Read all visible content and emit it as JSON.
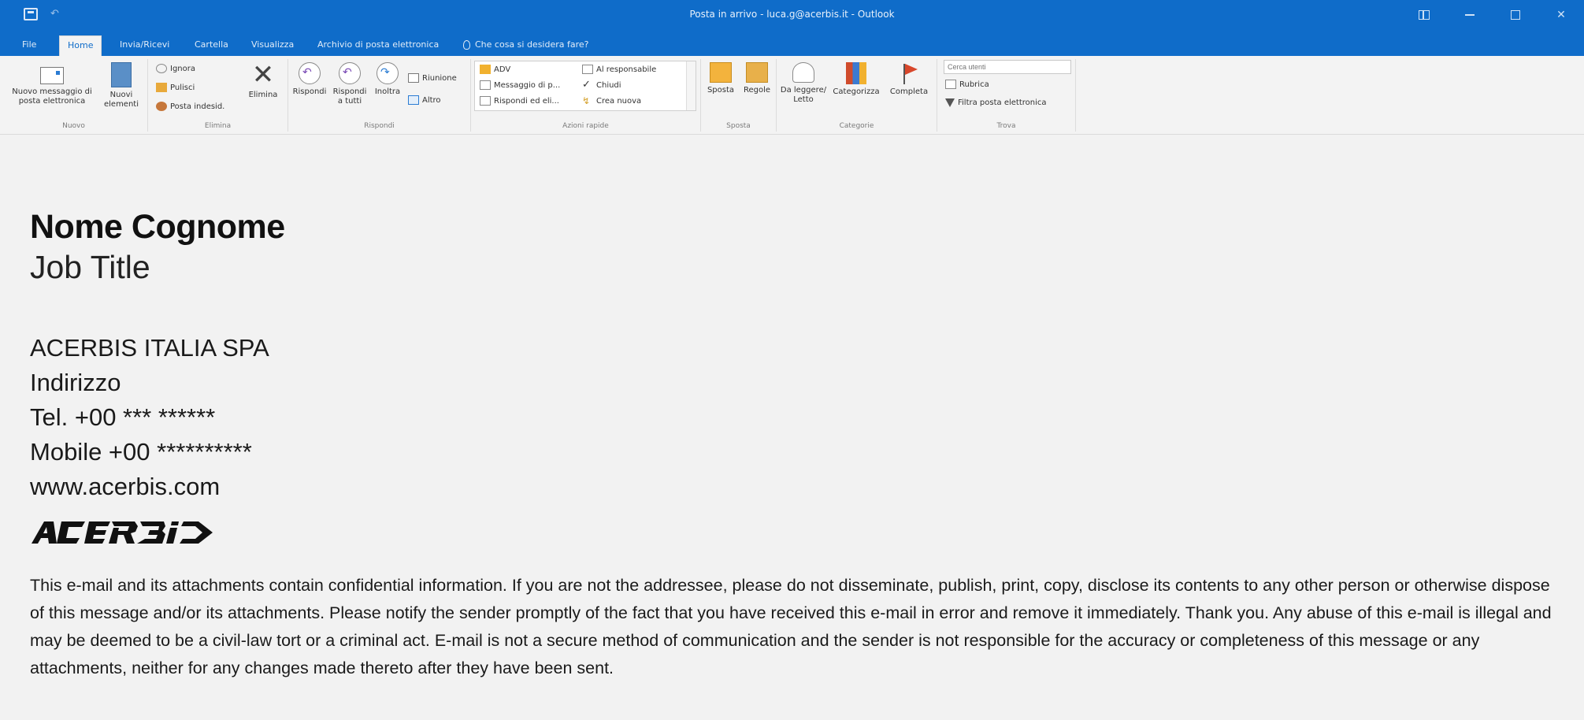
{
  "window": {
    "title": "Posta in arrivo - luca.g@acerbis.it - Outlook"
  },
  "tabs": [
    {
      "label": "File"
    },
    {
      "label": "Home"
    },
    {
      "label": "Invia/Ricevi"
    },
    {
      "label": "Cartella"
    },
    {
      "label": "Visualizza"
    },
    {
      "label": "Archivio di posta elettronica"
    }
  ],
  "tell_me": "Che cosa si desidera fare?",
  "ribbon": {
    "nuovo": {
      "label": "Nuovo",
      "new_message": "Nuovo messaggio di posta elettronica",
      "new_items": "Nuovi elementi"
    },
    "elimina": {
      "label": "Elimina",
      "ignore": "Ignora",
      "clean": "Pulisci",
      "junk": "Posta indesid.",
      "delete": "Elimina"
    },
    "rispondi": {
      "label": "Rispondi",
      "reply": "Rispondi",
      "reply_all": "Rispondi a tutti",
      "forward": "Inoltra",
      "meeting": "Riunione",
      "more": "Altro"
    },
    "azioni_rapide": {
      "label": "Azioni rapide",
      "items": [
        "ADV",
        "Al responsabile",
        "Messaggio di p...",
        "Chiudi",
        "Rispondi ed eli...",
        "Crea nuova"
      ]
    },
    "sposta": {
      "label": "Sposta",
      "move": "Sposta",
      "rules": "Regole"
    },
    "categorie": {
      "label": "Categorie",
      "read_unread": "Da leggere/ Letto",
      "categorize": "Categorizza",
      "followup": "Completa"
    },
    "trova": {
      "label": "Trova",
      "search_placeholder": "Cerca utenti",
      "address_book": "Rubrica",
      "filter": "Filtra posta elettronica"
    }
  },
  "signature": {
    "name": "Nome Cognome",
    "job_title": "Job Title",
    "company": "ACERBIS ITALIA SPA",
    "address": "Indirizzo",
    "tel": "Tel. +00 *** ******",
    "mobile": "Mobile +00 **********",
    "website": "www.acerbis.com",
    "logo": "ACERBIS"
  },
  "disclaimer": "This e-mail and its attachments contain confidential information. If you are not the addressee, please do not disseminate, publish, print, copy, disclose its contents to any other person or otherwise dispose of this message and/or its attachments. Please notify the sender promptly of the fact that you have received this e-mail in error and remove it immediately. Thank you. Any abuse of this e-mail is illegal and may be deemed to be a civil-law tort or a criminal act. E-mail is not a secure method of communication and the sender is not responsible for the accuracy or completeness of this message or any attachments, neither for any changes made thereto after they have been sent.",
  "colors": {
    "accent": "#0f6cc9",
    "ribbon_bg": "#f3f3f3",
    "body_bg": "#f2f2f2"
  }
}
